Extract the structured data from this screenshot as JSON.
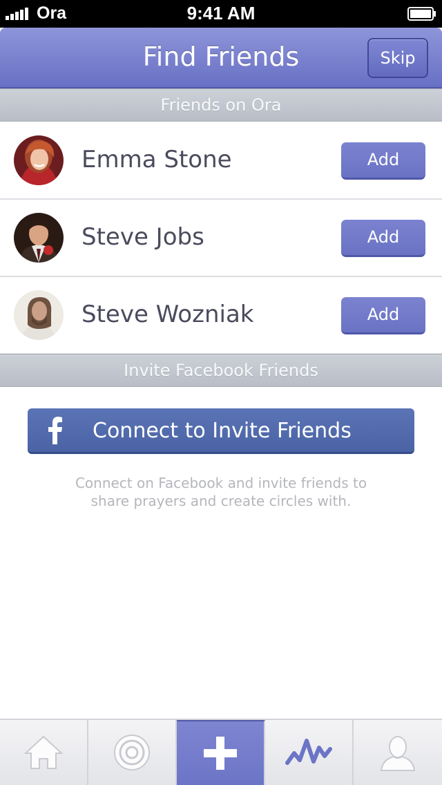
{
  "status_bar": {
    "carrier": "Ora",
    "time": "9:41 AM"
  },
  "navbar": {
    "title": "Find Friends",
    "skip_label": "Skip"
  },
  "sections": {
    "friends_on_ora": "Friends on Ora",
    "invite_facebook": "Invite Facebook Friends"
  },
  "friends": [
    {
      "name": "Emma Stone",
      "add_label": "Add"
    },
    {
      "name": "Steve Jobs",
      "add_label": "Add"
    },
    {
      "name": "Steve Wozniak",
      "add_label": "Add"
    }
  ],
  "facebook": {
    "icon": "facebook-f-icon",
    "button_label": "Connect to Invite Friends",
    "description_line1": "Connect on Facebook and invite friends to",
    "description_line2": "share prayers and create circles with."
  },
  "tabbar": {
    "tabs": [
      {
        "icon": "home-icon",
        "active": false
      },
      {
        "icon": "target-icon",
        "active": false
      },
      {
        "icon": "plus-icon",
        "active": true
      },
      {
        "icon": "activity-wave-icon",
        "active": false
      },
      {
        "icon": "profile-icon",
        "active": false
      }
    ]
  },
  "colors": {
    "accent": "#6d75c7",
    "facebook": "#4d66a8",
    "section_header": "#c3c7cf"
  }
}
